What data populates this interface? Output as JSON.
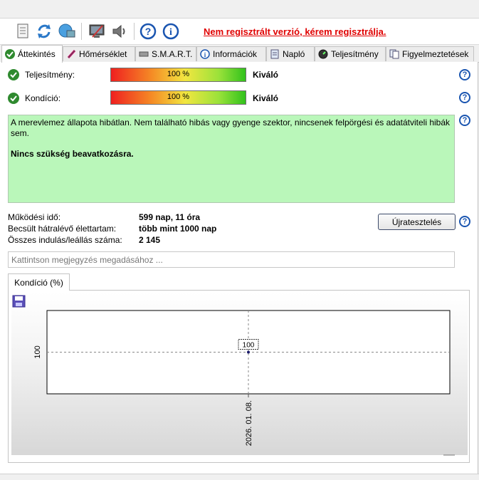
{
  "warning": "Nem regisztrált verzió, kérem regisztrálja.",
  "toolbar_icons": [
    "document-icon",
    "refresh-icon",
    "network-icon",
    "monitor-icon",
    "speaker-icon",
    "help-icon",
    "info-icon"
  ],
  "tabs": [
    {
      "label": "Áttekintés",
      "icon": "check-icon"
    },
    {
      "label": "Hőmérséklet",
      "icon": "thermometer-icon"
    },
    {
      "label": "S.M.A.R.T.",
      "icon": "drive-icon"
    },
    {
      "label": "Információk",
      "icon": "info-icon"
    },
    {
      "label": "Napló",
      "icon": "log-icon"
    },
    {
      "label": "Teljesítmény",
      "icon": "gauge-icon"
    },
    {
      "label": "Figyelmeztetések",
      "icon": "pages-icon"
    }
  ],
  "performance": {
    "label": "Teljesítmény:",
    "value": "100 %",
    "level": 1.0,
    "rating": "Kiváló"
  },
  "condition": {
    "label": "Kondíció:",
    "value": "100 %",
    "level": 1.0,
    "rating": "Kiváló"
  },
  "status": {
    "text": "A merevlemez állapota hibátlan. Nem található hibás vagy gyenge szektor, nincsenek felpörgési és adatátviteli hibák sem.",
    "bold": "Nincs szükség beavatkozásra."
  },
  "info": [
    {
      "label": "Működési idő:",
      "value": "599 nap, 11 óra"
    },
    {
      "label": "Becsült hátralévő élettartam:",
      "value": "több mint 1000 nap"
    },
    {
      "label": "Összes indulás/leállás száma:",
      "value": "2 145"
    }
  ],
  "retest_label": "Újratesztelés",
  "note_placeholder": "Kattintson megjegyzés megadásához ...",
  "chart_tab": "Kondíció  (%)",
  "chart_data": {
    "type": "line",
    "x": [
      "2026. 01. 08."
    ],
    "series": [
      {
        "values": [
          100
        ]
      }
    ],
    "data_labels": [
      "100"
    ],
    "ytick_labels": [
      "100"
    ],
    "xtick_labels": [
      "2026. 01. 08."
    ],
    "grid": true
  },
  "colors": {
    "accent": "#1a55b0",
    "status_bg": "#baf7ba",
    "warning": "#e00000"
  }
}
